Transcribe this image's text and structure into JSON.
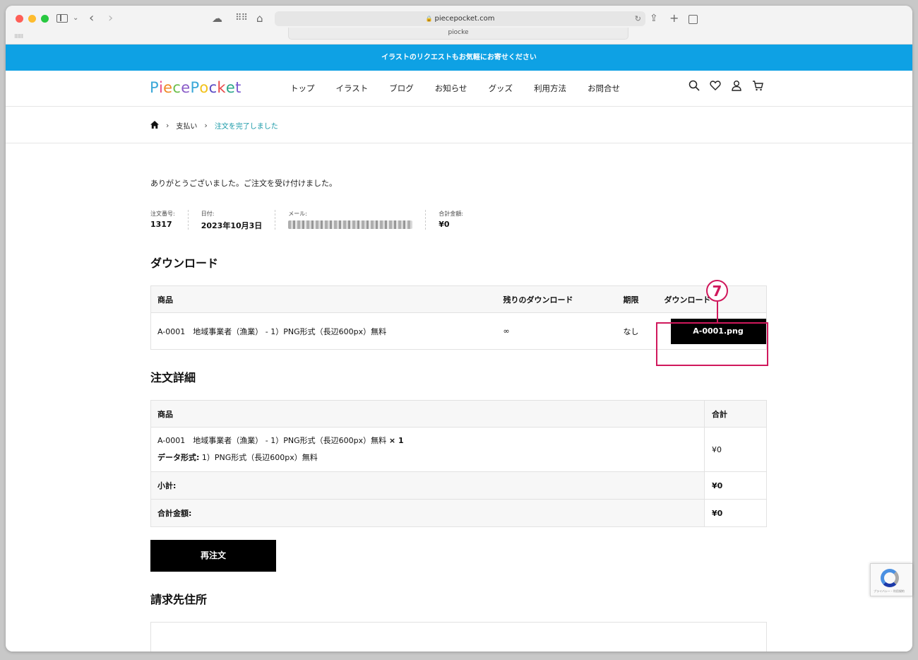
{
  "browser": {
    "url": "piecepocket.com",
    "tab_preview": "piocke"
  },
  "site": {
    "banner": "イラストのリクエストもお気軽にお寄せください",
    "logo_letters": [
      "P",
      "i",
      "e",
      "c",
      "e",
      "P",
      "o",
      "c",
      "k",
      "e",
      "t"
    ],
    "logo_colors": [
      "#3aa8d8",
      "#e84a8a",
      "#f08a24",
      "#6cbf4a",
      "#8a5cc8",
      "#3aa8d8",
      "#f2c21b",
      "#5b4cc4",
      "#e84a4a",
      "#2aa88a",
      "#7a5ad0"
    ],
    "nav": [
      "トップ",
      "イラスト",
      "ブログ",
      "お知らせ",
      "グッズ",
      "利用方法",
      "お問合せ"
    ],
    "icons": [
      "search-icon",
      "heart-icon",
      "user-icon",
      "cart-icon"
    ]
  },
  "breadcrumb": {
    "home_icon": "home-icon",
    "items": [
      "支払い",
      "注文を完了しました"
    ]
  },
  "order": {
    "thanks": "ありがとうございました。ご注文を受け付けました。",
    "meta": [
      {
        "label": "注文番号:",
        "value": "1317"
      },
      {
        "label": "日付:",
        "value": "2023年10月3日"
      },
      {
        "label": "メール:",
        "value": ""
      },
      {
        "label": "合計金額:",
        "value": "¥0"
      }
    ]
  },
  "downloads": {
    "title": "ダウンロード",
    "headers": [
      "商品",
      "残りのダウンロード",
      "期限",
      "ダウンロード"
    ],
    "row": {
      "product": "A-0001　地域事業者（漁業） - 1）PNG形式（長辺600px）無料",
      "remaining": "∞",
      "expires": "なし",
      "button": "A-0001.png"
    },
    "marker": "7"
  },
  "order_details": {
    "title": "注文詳細",
    "headers": [
      "商品",
      "合計"
    ],
    "item": {
      "name": "A-0001　地域事業者（漁業） - 1）PNG形式（長辺600px）無料",
      "qty": " × 1",
      "format_label": "データ形式:",
      "format_value": " 1）PNG形式（長辺600px）無料",
      "total": "¥0"
    },
    "subtotal_label": "小計:",
    "subtotal_value": "¥0",
    "total_label": "合計金額:",
    "total_value": "¥0"
  },
  "reorder_label": "再注文",
  "billing_title": "請求先住所",
  "recaptcha_text": "プライバシー・利用規約"
}
